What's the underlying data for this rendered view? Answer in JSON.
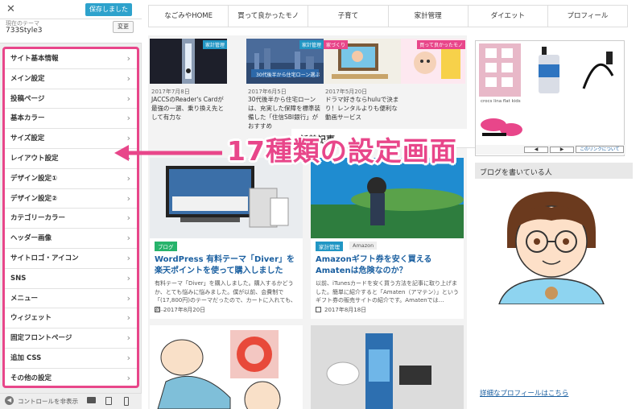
{
  "customizer": {
    "saved_label": "保存しました",
    "theme_small": "現在のテーマ",
    "theme_name": "733Style3",
    "change_label": "変更",
    "menu_items": [
      "サイト基本情報",
      "メイン設定",
      "投稿ページ",
      "基本カラー",
      "サイズ設定",
      "レイアウト設定",
      "デザイン設定①",
      "デザイン設定②",
      "カテゴリーカラー",
      "ヘッダー画像",
      "サイトロゴ・アイコン",
      "SNS",
      "メニュー",
      "ウィジェット",
      "固定フロントページ",
      "追加 CSS",
      "その他の設定"
    ],
    "hide_controls_label": "コントロールを非表示",
    "colors": {
      "highlight": "#e8468a",
      "saved_button": "#2ea2cc"
    }
  },
  "site": {
    "nav": [
      "なごみやHOME",
      "買って良かったモノ",
      "子育て",
      "家計管理",
      "ダイエット",
      "プロフィール"
    ],
    "top_posts": [
      {
        "tag": "家計管理",
        "date": "2017年7月8日",
        "title": "JACCSのReader's Cardが最強の一選、乗り換え先として有力な"
      },
      {
        "tag": "家計管理",
        "date": "2017年6月5日",
        "title": "30代後半から住宅ローンは、充実した保障を標準装備した「住信SBI銀行」がおすすめ",
        "image_text": "30代後半から住宅ローン選ぶ"
      },
      {
        "tag": "家づくり",
        "date": "2017年5月20日",
        "title": "ドラマ好きならhuluで決まり！レンタルよりも便利な動画サービス"
      },
      {
        "tag": "買って良かったモノ",
        "date": "",
        "title": ""
      }
    ],
    "section_title": "新着記事",
    "posts": [
      {
        "category": "ブログ",
        "title": "WordPress 有料テーマ「Diver」を楽天ポイントを使って購入しました",
        "excerpt": "有料テーマ「Diver」を購入しました。購入するかどうか、とても悩みに悩みました。僕が以前、会費制で「(17,800円)のテーマだったので、カートに入れても、あ…",
        "date": "2017年8月20日"
      },
      {
        "category": "家計管理",
        "category2": "Amazon",
        "title": "Amazonギフト券を安く買えるAmatenは危険なのか？",
        "excerpt": "以前、iTunesカードを安く買う方法を記事に取り上げました。簡単に紹介すると「Amaten（アマテン）」というギフト券の販売サイトの紹介です。Amatenでは…",
        "date": "2017年8月18日"
      }
    ],
    "ad_link_label": "このリンクについて",
    "ad_brand_label": "crocs lina flat kids",
    "profile_title": "ブログを書いている人",
    "profile_link": "詳細なプロフィールはこちら"
  },
  "annotation": {
    "text": "17種類の設定画面"
  }
}
